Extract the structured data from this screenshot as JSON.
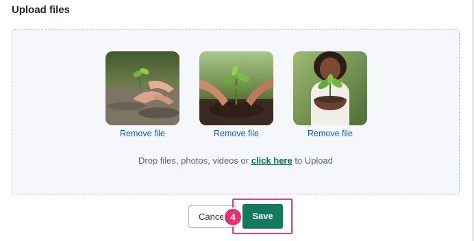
{
  "section": {
    "title": "Upload files"
  },
  "dropzone": {
    "files": [
      {
        "remove_label": "Remove file",
        "image": "hands-planting-seedling-in-soil-photo"
      },
      {
        "remove_label": "Remove file",
        "image": "hands-holding-green-sprout-photo"
      },
      {
        "remove_label": "Remove file",
        "image": "child-holding-plant-in-soil-photo"
      }
    ],
    "hint_prefix": "Drop files, photos, videos or ",
    "hint_link": "click here",
    "hint_suffix": " to Upload"
  },
  "actions": {
    "cancel_label": "Cancel",
    "save_label": "Save",
    "step_badge": "4"
  },
  "colors": {
    "primary": "#137a5e",
    "link": "#1a5cb8",
    "highlight": "#e23c7a",
    "badge": "#e2316f"
  }
}
